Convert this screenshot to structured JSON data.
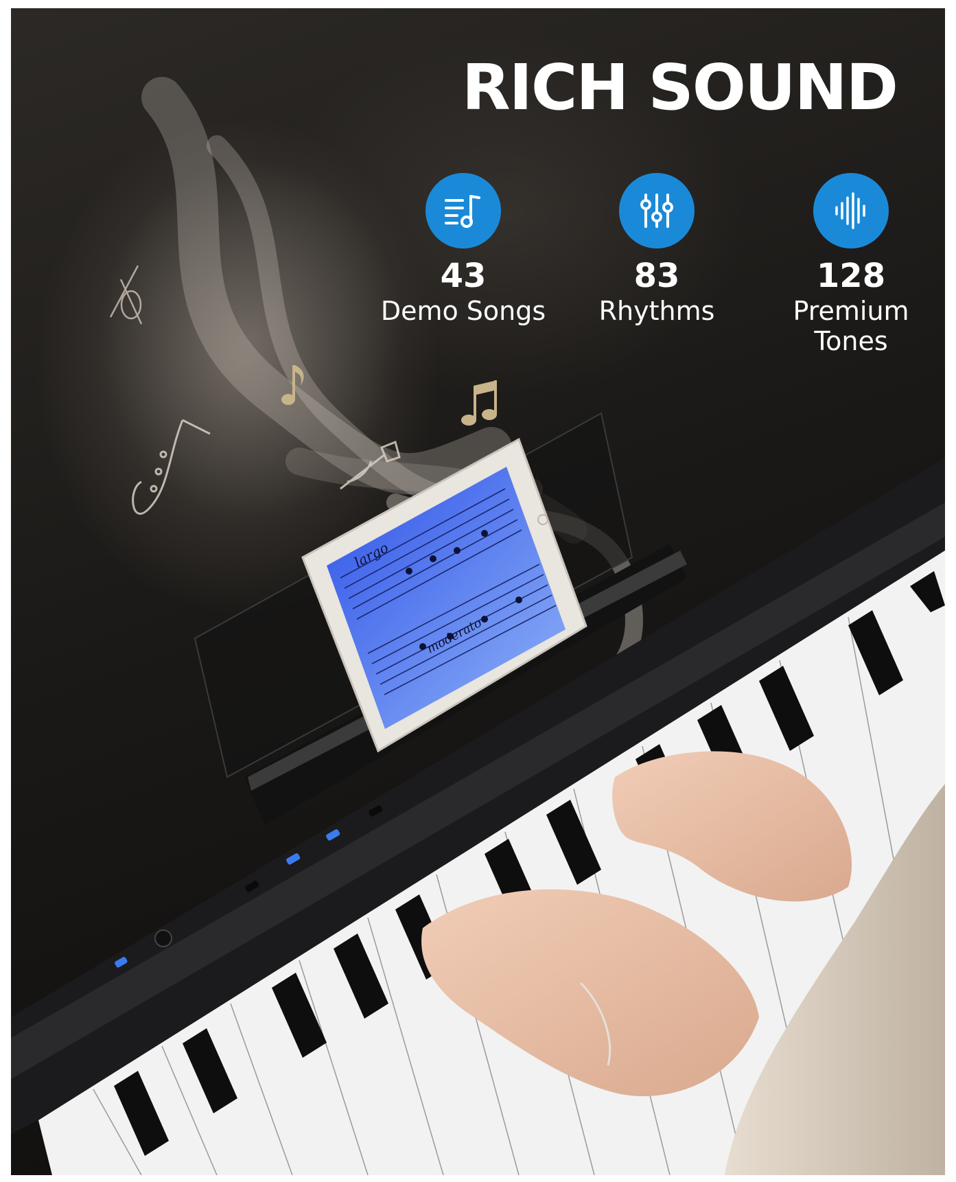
{
  "headline": "RICH SOUND",
  "stats": [
    {
      "number": "43",
      "label": "Demo Songs",
      "icon": "music-list-icon"
    },
    {
      "number": "83",
      "label": "Rhythms",
      "icon": "equalizer-sliders-icon"
    },
    {
      "number": "128",
      "label": "Premium Tones",
      "icon": "sound-wave-icon"
    }
  ],
  "tablet_sheet_music": {
    "tempo_marking_1": "largo",
    "tempo_marking_2": "moderato"
  },
  "colors": {
    "accent": "#1a8ad8",
    "background": "#1b1917",
    "headline": "#ffffff"
  }
}
